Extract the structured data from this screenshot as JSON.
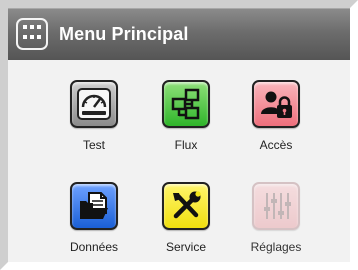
{
  "header": {
    "title": "Menu Principal",
    "menu_icon": "grid-menu-icon"
  },
  "tiles": [
    {
      "label": "Test",
      "icon": "speedometer-icon",
      "color": "#8a8a8a",
      "enabled": true
    },
    {
      "label": "Flux",
      "icon": "flowchart-icon",
      "color": "#35c230",
      "enabled": true
    },
    {
      "label": "Accès",
      "icon": "user-lock-icon",
      "color": "#f07f8a",
      "enabled": true
    },
    {
      "label": "Données",
      "icon": "folder-document-icon",
      "color": "#1a5fd6",
      "enabled": true
    },
    {
      "label": "Service",
      "icon": "tools-icon",
      "color": "#f2e51a",
      "enabled": true
    },
    {
      "label": "Réglages",
      "icon": "sliders-icon",
      "color": "#e89aa0",
      "enabled": false
    }
  ],
  "colors": {
    "header": "#6d6d6d",
    "background": "#f2f2f2"
  }
}
